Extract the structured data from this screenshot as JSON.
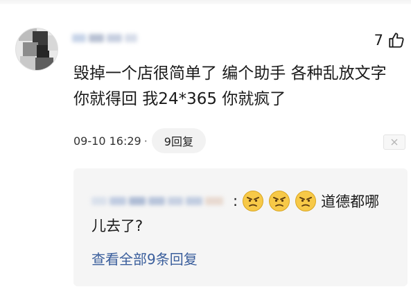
{
  "comment": {
    "like_count": "7",
    "text": "毁掉一个店很简单了 编个助手 各种乱放文字 你就得回 我24*365 你就疯了",
    "time": "09-10 16:29",
    "time_separator": "·",
    "reply_count_label": "9回复",
    "close_symbol": "×"
  },
  "reply": {
    "colon": ":",
    "emoji_name": "frowning-face-emoji",
    "text_line1": "道德都哪",
    "text_line2": "儿去了?",
    "view_all_label": "查看全部9条回复"
  },
  "watermark": "",
  "colors": {
    "link": "#3a5e9c",
    "pill_bg": "#f2f2f2",
    "reply_bg": "#f5f5f5",
    "emoji_face": "#f7c948"
  }
}
